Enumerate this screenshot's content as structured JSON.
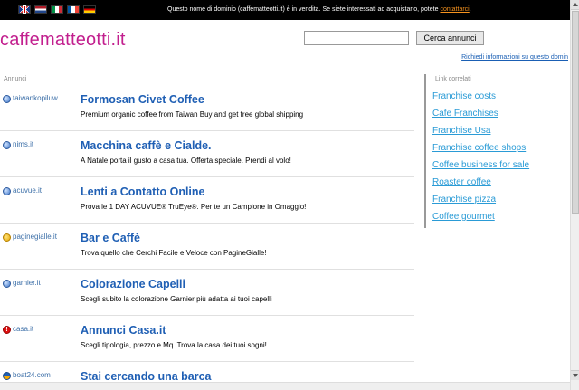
{
  "topbar": {
    "flags": [
      "uk-flag-icon",
      "nl-flag-icon",
      "it-flag-icon",
      "fr-flag-icon",
      "de-flag-icon"
    ],
    "notice_text": "Questo nome di dominio (caffematteotti.it) è in vendita. Se siete interessati ad acquistarlo, potete ",
    "notice_link": "contattarci",
    "notice_end": "."
  },
  "header": {
    "logo": "caffematteotti.it",
    "search_value": "",
    "search_button": "Cerca annunci",
    "info_link": "Richiedi informazioni su questo domin"
  },
  "main": {
    "section_label": "Annunci",
    "results": [
      {
        "icon": "globe-icon",
        "domain": "taiwankopiluw...",
        "title": "Formosan Civet Coffee",
        "desc": "Premium organic coffee from Taiwan Buy and get free global shipping"
      },
      {
        "icon": "globe-icon",
        "domain": "nims.it",
        "title": "Macchina caffè e Cialde.",
        "desc": "A Natale porta il gusto a casa tua. Offerta speciale. Prendi al volo!"
      },
      {
        "icon": "globe-icon",
        "domain": "acuvue.it",
        "title": "Lenti a Contatto Online",
        "desc": "Prova le 1 DAY ACUVUE® TruEye®. Per te un Campione in Omaggio!"
      },
      {
        "icon": "paginegialle-icon",
        "domain": "paginegialle.it",
        "title": "Bar e Caffè",
        "desc": "Trova quello che Cerchi Facile e Veloce con PagineGialle!"
      },
      {
        "icon": "globe-icon",
        "domain": "garnier.it",
        "title": "Colorazione Capelli",
        "desc": "Scegli subito la colorazione Garnier più adatta ai tuoi capelli"
      },
      {
        "icon": "alert-icon",
        "domain": "casa.it",
        "title": "Annunci Casa.it",
        "desc": "Scegli tipologia, prezzo e Mq. Trova la casa dei tuoi sogni!"
      },
      {
        "icon": "boat-icon",
        "domain": "boat24.com",
        "title": "Stai cercando una barca",
        "desc": ""
      }
    ]
  },
  "sidebar": {
    "label": "Link correlati",
    "links": [
      "Franchise costs",
      "Cafe Franchises",
      "Franchise Usa",
      "Franchise coffee shops",
      "Coffee business for sale",
      "Roaster coffee",
      "Franchise pizza",
      "Coffee gourmet"
    ]
  },
  "colors": {
    "logo": "#c21f8e",
    "result_title": "#1f5fb4",
    "related_link": "#2a9bd6",
    "notice_link": "#f7931e"
  }
}
